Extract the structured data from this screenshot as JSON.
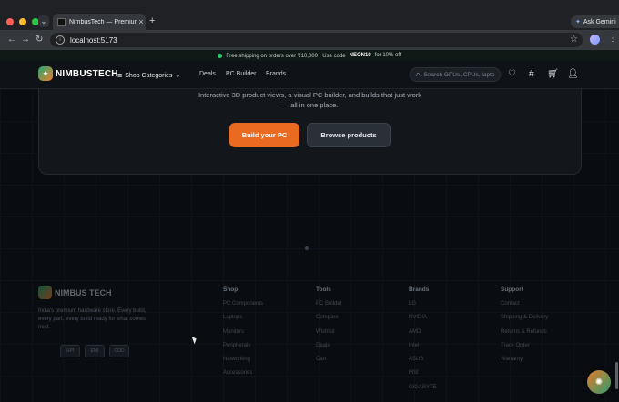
{
  "browser": {
    "tab_title": "NimbusTech — Premium Hard",
    "tab_close": "×",
    "new_tab": "+",
    "ask_label": "Ask Gemini",
    "url": "localhost:5173",
    "back": "←",
    "forward": "→",
    "reload": "↻",
    "tab_list": "⌄"
  },
  "promo": {
    "text_before": "Free shipping on orders over ₹10,000 · Use code",
    "code": "NEON10",
    "text_after": "for 10% off"
  },
  "header": {
    "brand": "NIMBUSTECH",
    "categories_label": "Shop Categories",
    "nav": [
      "Deals",
      "PC Builder",
      "Brands"
    ],
    "search_placeholder": "Search GPUs, CPUs, lapto"
  },
  "hero": {
    "line1": "Interactive 3D product views, a visual PC builder, and builds that just work",
    "line2": "— all in one place.",
    "primary_cta": "Build your PC",
    "secondary_cta": "Browse products"
  },
  "footer": {
    "brand": "NIMBUS TECH",
    "description": "India's premium hardware store. Every build, every part, every build ready for what comes next.",
    "pills": [
      "UPI",
      "EMI",
      "COD"
    ],
    "columns": [
      {
        "title": "Shop",
        "links": [
          "PC Components",
          "Laptops",
          "Monitors",
          "Peripherals",
          "Networking",
          "Accessories"
        ]
      },
      {
        "title": "Tools",
        "links": [
          "PC Builder",
          "Compare",
          "Wishlist",
          "Deals",
          "Cart"
        ]
      },
      {
        "title": "Brands",
        "links": [
          "LG",
          "NVIDIA",
          "AMD",
          "Intel",
          "ASUS",
          "MSI",
          "GIGABYTE"
        ]
      },
      {
        "title": "Support",
        "links": [
          "Contact",
          "Shipping & Delivery",
          "Returns & Refunds",
          "Track Order",
          "Warranty"
        ]
      }
    ]
  },
  "colors": {
    "accent_orange": "#ea6a22",
    "accent_green": "#1fa974",
    "background": "#090c10"
  }
}
